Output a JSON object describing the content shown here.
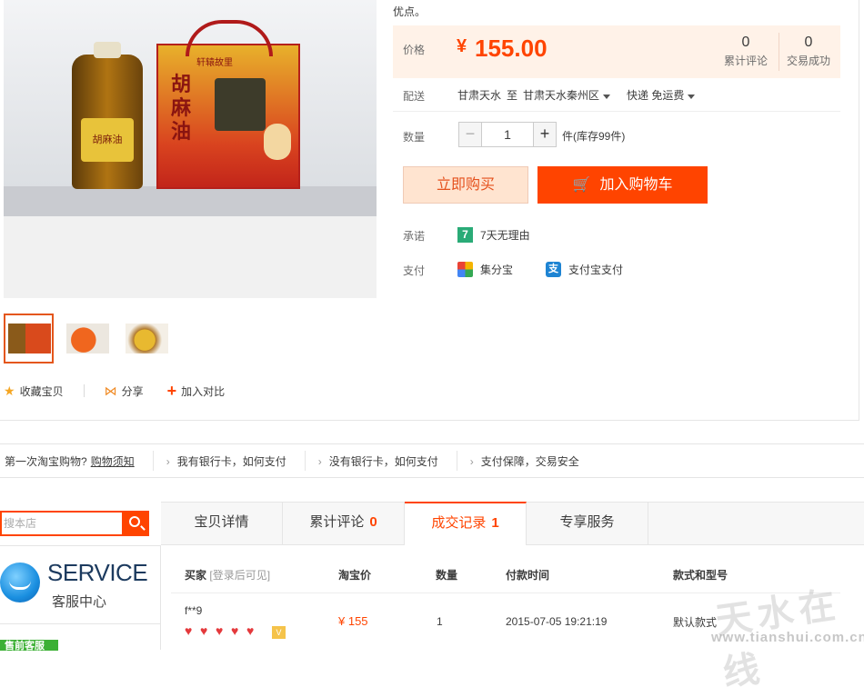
{
  "product": {
    "desc_tail": "优点。",
    "photo_bottle_label": "胡麻油",
    "photo_box_title": "胡麻油",
    "photo_box_slogan": "轩辕故里"
  },
  "price_box": {
    "label": "价格",
    "currency": "¥",
    "price": "155.00",
    "reviews_count": "0",
    "reviews_label": "累计评论",
    "deals_count": "0",
    "deals_label": "交易成功"
  },
  "shipping": {
    "label": "配送",
    "from": "甘肃天水",
    "to_word": "至",
    "destination": "甘肃天水秦州区",
    "method": "快递 免运费"
  },
  "quantity": {
    "label": "数量",
    "minus": "−",
    "value": "1",
    "plus": "+",
    "stock_text": "件(库存99件)"
  },
  "buttons": {
    "buy_now": "立即购买",
    "add_to_cart": "加入购物车"
  },
  "promise": {
    "label": "承诺",
    "icon_text": "7",
    "text": "7天无理由"
  },
  "payment": {
    "label": "支付",
    "option1": "集分宝",
    "alipay_icon_text": "支",
    "option2": "支付宝支付"
  },
  "actions": {
    "favorite": "收藏宝贝",
    "share": "分享",
    "compare": "加入对比"
  },
  "info_strip": {
    "first_text": "第一次淘宝购物?",
    "first_link": "购物须知",
    "items": [
      "我有银行卡，如何支付",
      "没有银行卡，如何支付",
      "支付保障，交易安全"
    ]
  },
  "shop_search": {
    "placeholder": "搜本店"
  },
  "service": {
    "title_en": "SERVICE",
    "title_cn": "客服中心",
    "presale": "售前客服"
  },
  "tabs": [
    {
      "label": "宝贝详情",
      "count": ""
    },
    {
      "label": "累计评论",
      "count": "0"
    },
    {
      "label": "成交记录",
      "count": "1"
    },
    {
      "label": "专享服务",
      "count": ""
    }
  ],
  "records": {
    "headers": {
      "buyer": "买家",
      "buyer_note": "[登录后可见]",
      "price": "淘宝价",
      "qty": "数量",
      "time": "付款时间",
      "sku": "款式和型号"
    },
    "rows": [
      {
        "buyer": "f**9",
        "price": "¥ 155",
        "qty": "1",
        "time": "2015-07-05 19:21:19",
        "sku": "默认款式",
        "hearts": 5
      }
    ]
  },
  "watermark": {
    "text": "天水在线",
    "url": "www.tianshui.com.cn"
  },
  "colors": {
    "accent": "#ff4400",
    "price_bg": "#fff2e8",
    "buy_now_bg": "#ffe4d0"
  }
}
